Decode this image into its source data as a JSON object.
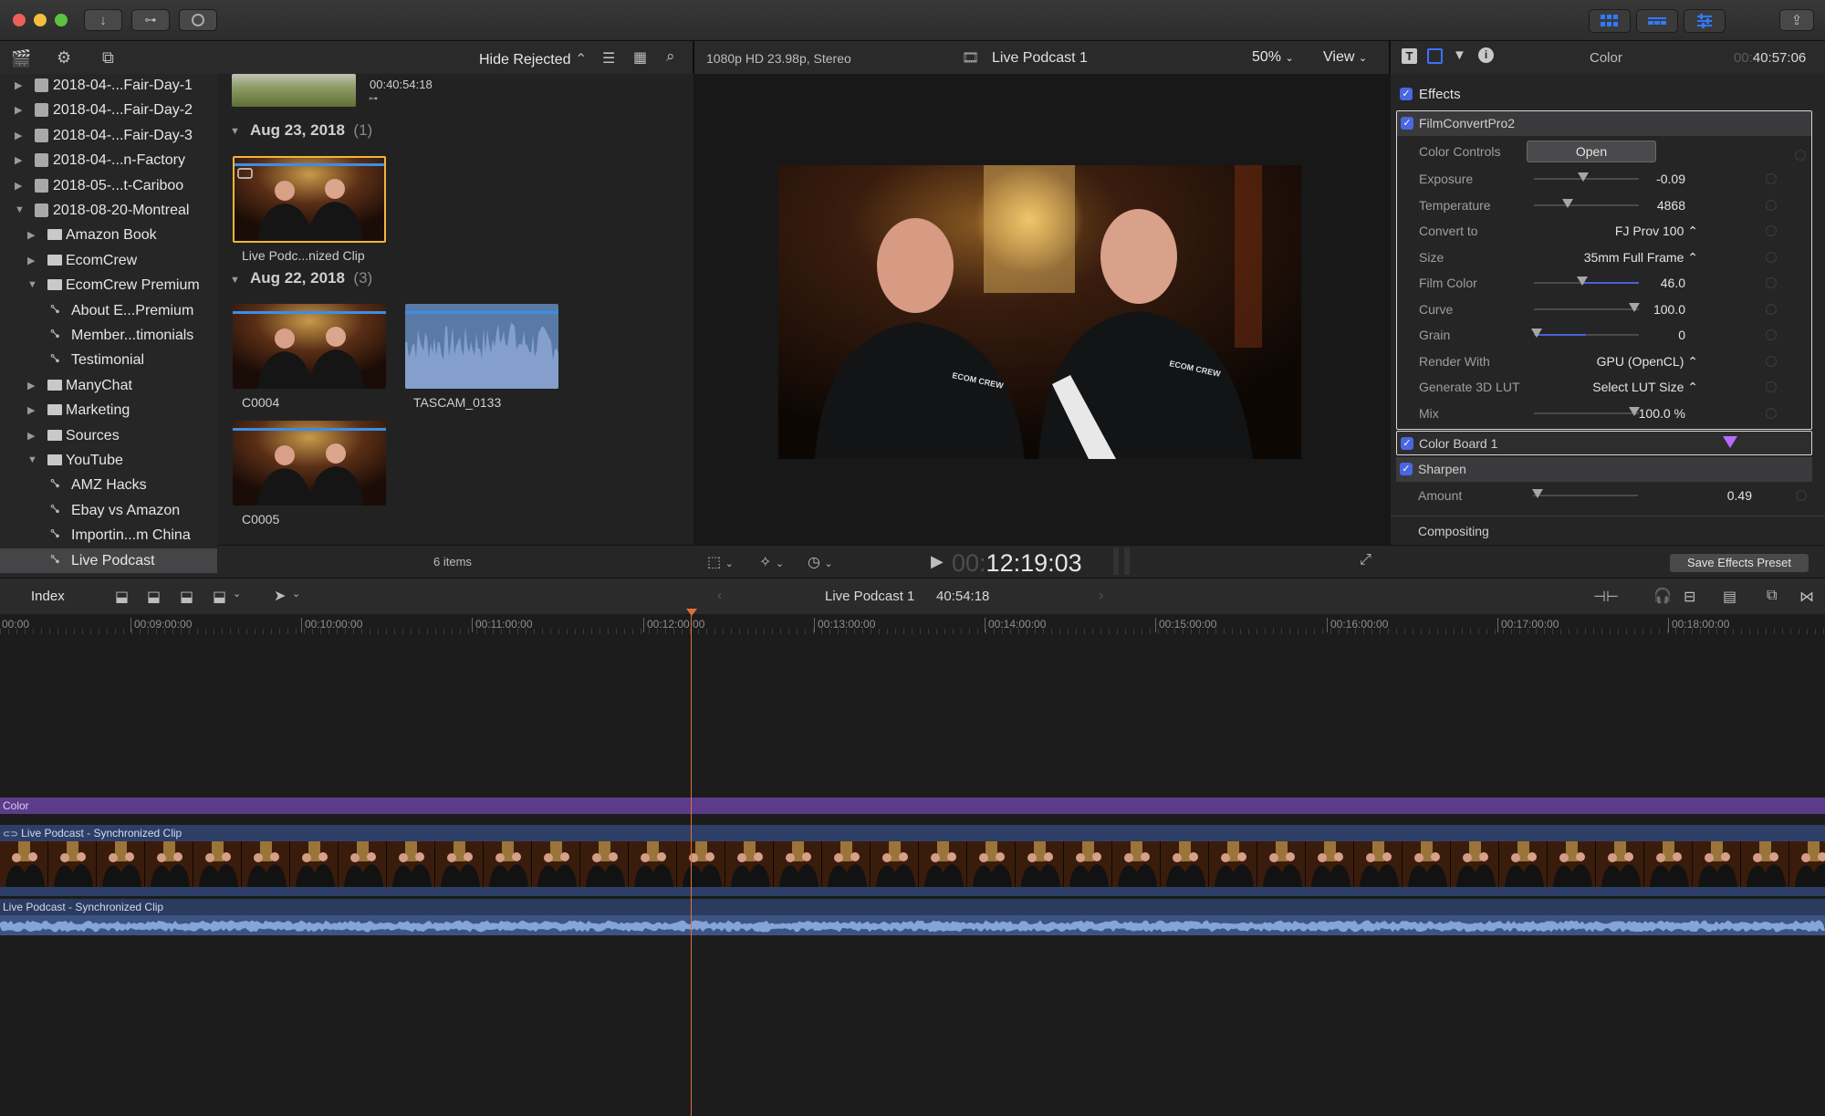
{
  "toolbar": {
    "buttons": [
      "download-icon",
      "key-icon",
      "background-tasks-icon"
    ],
    "workspace_buttons": [
      "browser-layout-icon",
      "timeline-layout-icon",
      "inspector-layout-icon"
    ],
    "share_icon": "share-icon"
  },
  "library": {
    "items": [
      {
        "label": "2018-04-...Fair-Day-1",
        "type": "event",
        "expanded": false,
        "indent": 0
      },
      {
        "label": "2018-04-...Fair-Day-2",
        "type": "event",
        "expanded": false,
        "indent": 0
      },
      {
        "label": "2018-04-...Fair-Day-3",
        "type": "event",
        "expanded": false,
        "indent": 0
      },
      {
        "label": "2018-04-...n-Factory",
        "type": "event",
        "expanded": false,
        "indent": 0
      },
      {
        "label": "2018-05-...t-Cariboo",
        "type": "event",
        "expanded": false,
        "indent": 0
      },
      {
        "label": "2018-08-20-Montreal",
        "type": "event",
        "expanded": true,
        "indent": 0
      },
      {
        "label": "Amazon Book",
        "type": "folder",
        "expanded": false,
        "indent": 1
      },
      {
        "label": "EcomCrew",
        "type": "folder",
        "expanded": false,
        "indent": 1
      },
      {
        "label": "EcomCrew Premium",
        "type": "folder",
        "expanded": true,
        "indent": 1
      },
      {
        "label": "About E...Premium",
        "type": "keyword",
        "indent": 2
      },
      {
        "label": "Member...timonials",
        "type": "keyword",
        "indent": 2
      },
      {
        "label": "Testimonial",
        "type": "keyword",
        "indent": 2
      },
      {
        "label": "ManyChat",
        "type": "folder",
        "expanded": false,
        "indent": 1
      },
      {
        "label": "Marketing",
        "type": "folder",
        "expanded": false,
        "indent": 1
      },
      {
        "label": "Sources",
        "type": "folder",
        "expanded": false,
        "indent": 1
      },
      {
        "label": "YouTube",
        "type": "folder",
        "expanded": true,
        "indent": 1
      },
      {
        "label": "AMZ Hacks",
        "type": "keyword",
        "indent": 2
      },
      {
        "label": "Ebay vs Amazon",
        "type": "keyword",
        "indent": 2
      },
      {
        "label": "Importin...m China",
        "type": "keyword",
        "indent": 2
      },
      {
        "label": "Live Podcast",
        "type": "keyword",
        "indent": 2,
        "selected": true
      }
    ]
  },
  "browser": {
    "filter": "Hide Rejected",
    "top_clip_duration": "00:40:54:18",
    "groups": [
      {
        "date": "Aug 23, 2018",
        "count": "(1)"
      },
      {
        "date": "Aug 22, 2018",
        "count": "(3)"
      }
    ],
    "clips": {
      "sync": "Live Podc...nized Clip",
      "c0004": "C0004",
      "tascam": "TASCAM_0133",
      "c0005": "C0005"
    },
    "items_count": "6 items"
  },
  "viewer": {
    "format": "1080p HD 23.98p, Stereo",
    "project": "Live Podcast 1",
    "zoom": "50%",
    "view_label": "View",
    "timecode_dim": "00:",
    "timecode": "12:19:03",
    "logo_text": "ECOM CREW"
  },
  "inspector": {
    "title": "Color",
    "duration_dim": "00:",
    "duration": "40:57:06",
    "effects_label": "Effects",
    "filmconvert": {
      "name": "FilmConvertPro2",
      "color_controls": "Color Controls",
      "open_button": "Open",
      "params": [
        {
          "label": "Exposure",
          "value": "-0.09",
          "slider": 0.47,
          "fill": false
        },
        {
          "label": "Temperature",
          "value": "4868",
          "slider": 0.32,
          "fill": false
        },
        {
          "label": "Convert to",
          "value": "FJ Prov 100 ⌃",
          "popup": true
        },
        {
          "label": "Size",
          "value": "35mm Full Frame ⌃",
          "popup": true
        },
        {
          "label": "Film Color",
          "value": "46.0",
          "slider": 0.46,
          "fill": true
        },
        {
          "label": "Curve",
          "value": "100.0",
          "slider": 0.96,
          "fill": false
        },
        {
          "label": "Grain",
          "value": "0",
          "slider": 0.03,
          "fill": true,
          "fill_to": 0.5
        },
        {
          "label": "Render With",
          "value": "GPU (OpenCL) ⌃",
          "popup": true
        },
        {
          "label": "Generate 3D LUT",
          "value": "Select LUT Size ⌃",
          "popup": true
        },
        {
          "label": "Mix",
          "value": "100.0 %",
          "slider": 0.96,
          "fill": false
        }
      ]
    },
    "color_board": "Color Board 1",
    "sharpen": "Sharpen",
    "amount_label": "Amount",
    "amount_value": "0.49",
    "compositing": "Compositing",
    "save_preset": "Save Effects Preset"
  },
  "timeline": {
    "index_label": "Index",
    "project": "Live Podcast 1",
    "duration": "40:54:18",
    "ruler": [
      "00:00",
      "00:09:00:00",
      "00:10:00:00",
      "00:11:00:00",
      "00:12:00:00",
      "00:13:00:00",
      "00:14:00:00",
      "00:15:00:00",
      "00:16:00:00",
      "00:17:00:00",
      "00:18:00:00"
    ],
    "tracks": {
      "color": "Color",
      "video": "Live Podcast - Synchronized Clip",
      "audio": "Live Podcast - Synchronized Clip"
    }
  },
  "colors": {
    "accent": "#4a66e0",
    "playhead": "#e0703a",
    "color_track": "#5b3b8a",
    "video_track": "#2d3f66",
    "audio_track": "#3b5482"
  }
}
